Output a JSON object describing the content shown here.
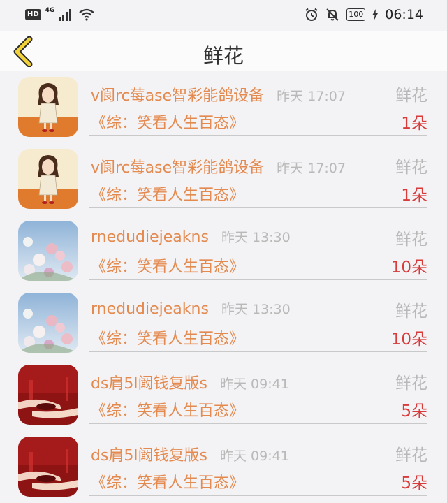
{
  "status_bar": {
    "hd_label": "HD",
    "network_label": "4G",
    "battery_label": "100",
    "time": "06:14"
  },
  "header": {
    "title": "鲜花"
  },
  "items": [
    {
      "name": "v阆rc莓ase智彩能鸽设备",
      "time": "昨天 17:07",
      "type": "鲜花",
      "book": "《综：笑看人生百态》",
      "count": "1朵",
      "avatar": "girl-illustration"
    },
    {
      "name": "v阆rc莓ase智彩能鸽设备",
      "time": "昨天 17:07",
      "type": "鲜花",
      "book": "《综：笑看人生百态》",
      "count": "1朵",
      "avatar": "girl-illustration"
    },
    {
      "name": "rnedudiejeakns",
      "time": "昨天 13:30",
      "type": "鲜花",
      "book": "《综：笑看人生百态》",
      "count": "10朵",
      "avatar": "flowers-photo"
    },
    {
      "name": "rnedudiejeakns",
      "time": "昨天 13:30",
      "type": "鲜花",
      "book": "《综：笑看人生百态》",
      "count": "10朵",
      "avatar": "flowers-photo"
    },
    {
      "name": "ds肩5l阚钱复版s",
      "time": "昨天 09:41",
      "type": "鲜花",
      "book": "《综：笑看人生百态》",
      "count": "5朵",
      "avatar": "red-hands-photo"
    },
    {
      "name": "ds肩5l阚钱复版s",
      "time": "昨天 09:41",
      "type": "鲜花",
      "book": "《综：笑看人生百态》",
      "count": "5朵",
      "avatar": "red-hands-photo"
    }
  ],
  "colors": {
    "name": "#e48a4f",
    "count": "#d93b3b",
    "muted": "#b8b8b8",
    "back_icon": "#f2d23a"
  }
}
